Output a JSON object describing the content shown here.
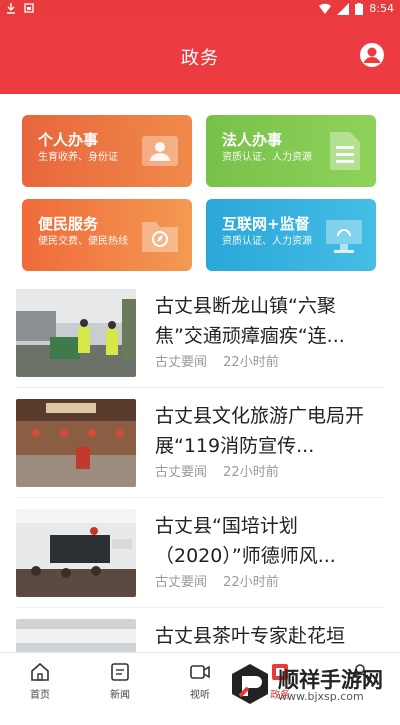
{
  "status_bar": {
    "time": "8:54"
  },
  "header": {
    "title": "政务"
  },
  "cards": [
    {
      "title": "个人办事",
      "subtitle": "生育收养、身份证",
      "icon": "id-card-icon"
    },
    {
      "title": "法人办事",
      "subtitle": "资质认证、人力资源",
      "icon": "document-icon"
    },
    {
      "title": "便民服务",
      "subtitle": "便民交费、便民热线",
      "icon": "folder-icon"
    },
    {
      "title": "互联网+监督",
      "subtitle": "资质认证、人力资源",
      "icon": "monitor-icon"
    }
  ],
  "news": [
    {
      "title": "古丈县断龙山镇“六聚焦”交通顽瘴痼疾“连...",
      "source": "古丈要闻",
      "time": "22小时前"
    },
    {
      "title": "古丈县文化旅游广电局开展“119消防宣传...",
      "source": "古丈要闻",
      "time": "22小时前"
    },
    {
      "title": "古丈县“国培计划（2020）”师德师风...",
      "source": "古丈要闻",
      "time": "22小时前"
    },
    {
      "title": "古丈县茶叶专家赴花垣",
      "source": "",
      "time": ""
    }
  ],
  "tabbar": [
    {
      "label": "首页",
      "icon": "home-icon"
    },
    {
      "label": "新闻",
      "icon": "news-icon"
    },
    {
      "label": "视听",
      "icon": "video-icon"
    },
    {
      "label": "政务",
      "icon": "government-icon"
    },
    {
      "label": "",
      "icon": "profile-icon"
    }
  ],
  "watermark": {
    "text": "顺祥手游网",
    "url": "www.bjxsp.com"
  },
  "colors": {
    "primary": "#ec3c42"
  }
}
